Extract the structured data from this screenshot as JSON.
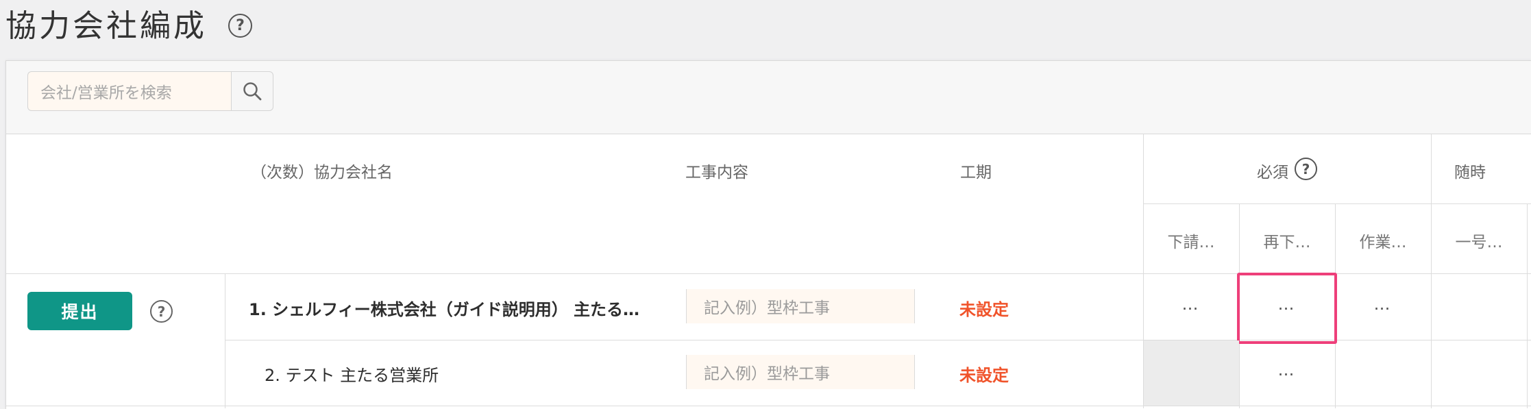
{
  "page": {
    "title": "協力会社編成",
    "help_symbol": "?"
  },
  "search": {
    "placeholder": "会社/営業所を検索",
    "icon": "search-icon"
  },
  "table": {
    "headers": {
      "company_name": "（次数）協力会社名",
      "work_content": "工事内容",
      "period": "工期",
      "required": "必須",
      "optional": "随時"
    },
    "sub_headers": [
      "下請…",
      "再下…",
      "作業…",
      "一号…"
    ],
    "submit_label": "提出",
    "rows": [
      {
        "company": "1. シェルフィー株式会社（ガイド説明用） 主たる…",
        "work_placeholder": "記入例）型枠工事",
        "period": "未設定",
        "cells": [
          "…",
          "…",
          "…"
        ]
      },
      {
        "company": "2. テスト 主たる営業所",
        "work_placeholder": "記入例）型枠工事",
        "period": "未設定",
        "cells": [
          "…"
        ]
      }
    ]
  },
  "colors": {
    "submit_bg": "#0f9687",
    "period_text": "#f0532a",
    "highlight_border": "#ee3f7a",
    "input_bg": "#fff8f1"
  }
}
